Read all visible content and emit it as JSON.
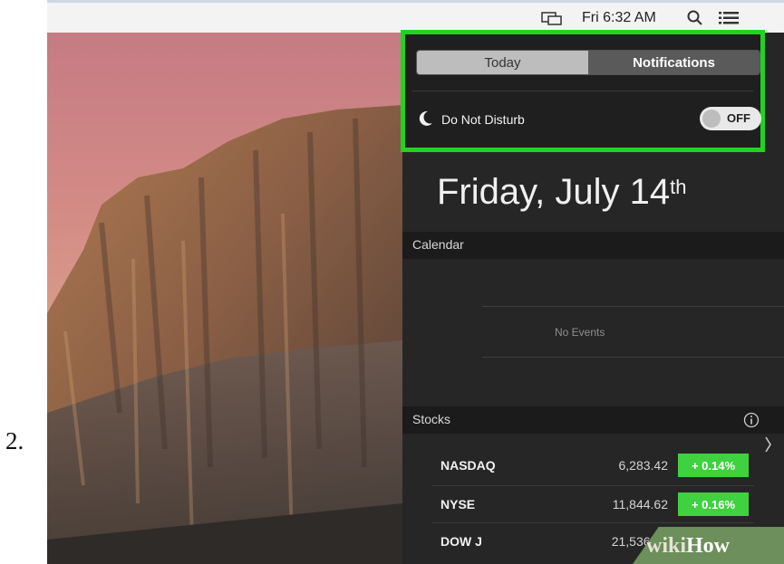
{
  "step": {
    "number": "2."
  },
  "menubar": {
    "time": "Fri 6:32 AM",
    "icons": [
      "display-icon",
      "search-icon",
      "list-icon"
    ]
  },
  "notification_center": {
    "tabs": [
      {
        "label": "Today",
        "selected": true
      },
      {
        "label": "Notifications",
        "selected": false
      }
    ],
    "do_not_disturb": {
      "label": "Do Not Disturb",
      "state": "OFF"
    },
    "date": {
      "text": "Friday, July 14",
      "suffix": "th"
    },
    "calendar": {
      "title": "Calendar",
      "empty_text": "No Events"
    },
    "stocks": {
      "title": "Stocks",
      "rows": [
        {
          "symbol": "NASDAQ",
          "price": "6,283.42",
          "change": "+ 0.14%"
        },
        {
          "symbol": "NYSE",
          "price": "11,844.62",
          "change": "+ 0.16%"
        },
        {
          "symbol": "DOW J",
          "price": "21,536.15",
          "change": ""
        }
      ]
    }
  },
  "highlight_color": "#21d321",
  "positive_color": "#3fd13f",
  "watermark": {
    "prefix": "wiki",
    "suffix": "How"
  }
}
